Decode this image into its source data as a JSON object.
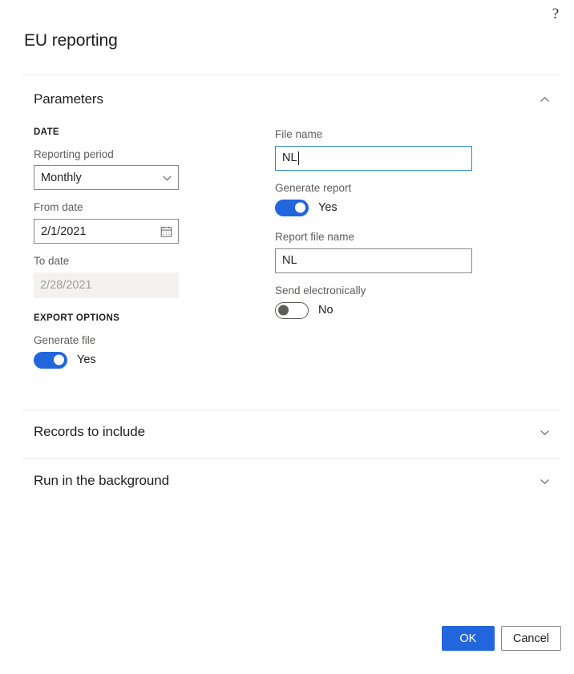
{
  "header": {
    "title": "EU reporting",
    "help_icon": "question-mark-icon"
  },
  "sections": {
    "parameters": {
      "label": "Parameters",
      "expanded": true,
      "chevron": "chevron-up-icon"
    },
    "records_to_include": {
      "label": "Records to include",
      "expanded": false,
      "chevron": "chevron-down-icon"
    },
    "run_in_the_background": {
      "label": "Run in the background",
      "expanded": false,
      "chevron": "chevron-down-icon"
    }
  },
  "left_column": {
    "date_group_title": "DATE",
    "reporting_period": {
      "label": "Reporting period",
      "value": "Monthly",
      "icon": "chevron-down-icon"
    },
    "from_date": {
      "label": "From date",
      "value": "2/1/2021",
      "icon": "calendar-icon"
    },
    "to_date": {
      "label": "To date",
      "value": "2/28/2021",
      "disabled": true
    },
    "export_group_title": "EXPORT OPTIONS",
    "generate_file": {
      "label": "Generate file",
      "state": "on",
      "state_text": "Yes"
    }
  },
  "right_column": {
    "file_name": {
      "label": "File name",
      "value": "NL",
      "focused": true
    },
    "generate_report": {
      "label": "Generate report",
      "state": "on",
      "state_text": "Yes"
    },
    "report_file_name": {
      "label": "Report file name",
      "value": "NL",
      "focused": false
    },
    "send_electronically": {
      "label": "Send electronically",
      "state": "off",
      "state_text": "No"
    }
  },
  "footer": {
    "ok_label": "OK",
    "cancel_label": "Cancel"
  },
  "colors": {
    "accent": "#2266dd",
    "focus_border": "#2b88d8",
    "label_text": "#605e5c",
    "body_text": "#201f1e",
    "disabled_bg": "#f3f2f1",
    "divider": "#edebe9"
  }
}
